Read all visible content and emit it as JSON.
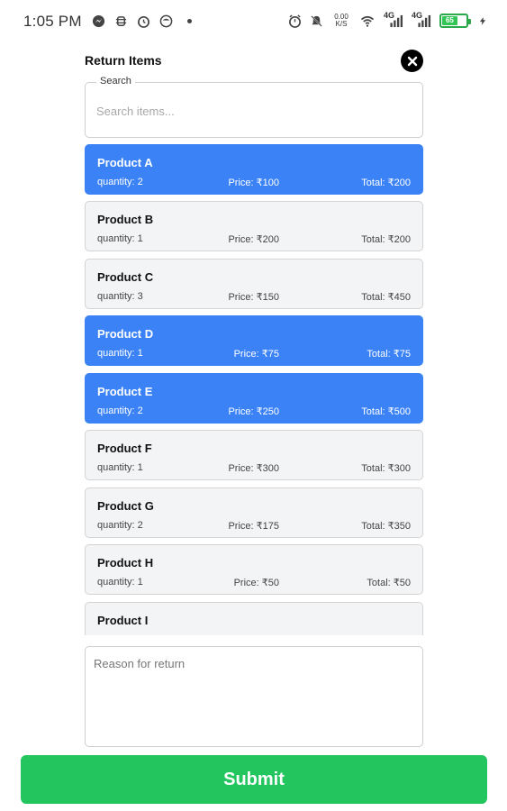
{
  "status_bar": {
    "time": "1:05 PM",
    "speed_value": "0.00",
    "speed_unit": "K/S",
    "net1": "4G",
    "net2": "4G",
    "battery": "65",
    "icons": [
      "messenger-icon",
      "bug-icon",
      "alarm-icon",
      "app-icon",
      "alarm-clock-icon",
      "mute-icon",
      "wifi-icon",
      "signal-icon",
      "battery-icon",
      "charging-icon"
    ]
  },
  "header": {
    "title": "Return Items",
    "close_icon": "close-icon"
  },
  "search": {
    "legend": "Search",
    "placeholder": "Search items..."
  },
  "items": [
    {
      "name": "Product A",
      "quantity": "quantity: 2",
      "price": "Price: ₹100",
      "total": "Total: ₹200",
      "selected": true
    },
    {
      "name": "Product B",
      "quantity": "quantity: 1",
      "price": "Price: ₹200",
      "total": "Total: ₹200",
      "selected": false
    },
    {
      "name": "Product C",
      "quantity": "quantity: 3",
      "price": "Price: ₹150",
      "total": "Total: ₹450",
      "selected": false
    },
    {
      "name": "Product D",
      "quantity": "quantity: 1",
      "price": "Price: ₹75",
      "total": "Total: ₹75",
      "selected": true
    },
    {
      "name": "Product E",
      "quantity": "quantity: 2",
      "price": "Price: ₹250",
      "total": "Total: ₹500",
      "selected": true
    },
    {
      "name": "Product F",
      "quantity": "quantity: 1",
      "price": "Price: ₹300",
      "total": "Total: ₹300",
      "selected": false
    },
    {
      "name": "Product G",
      "quantity": "quantity: 2",
      "price": "Price: ₹175",
      "total": "Total: ₹350",
      "selected": false
    },
    {
      "name": "Product H",
      "quantity": "quantity: 1",
      "price": "Price: ₹50",
      "total": "Total: ₹50",
      "selected": false
    },
    {
      "name": "Product I",
      "quantity": "",
      "price": "",
      "total": "",
      "selected": false
    }
  ],
  "reason": {
    "placeholder": "Reason for return"
  },
  "submit": {
    "label": "Submit"
  },
  "colors": {
    "selected": "#3b82f6",
    "unselected": "#f3f4f6",
    "submit": "#22c55e",
    "battery": "#32c554"
  }
}
